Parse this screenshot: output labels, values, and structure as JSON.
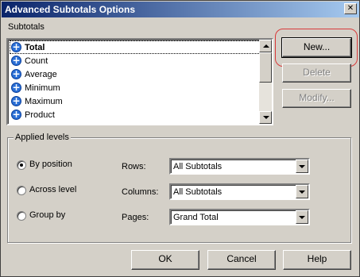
{
  "window": {
    "title": "Advanced Subtotals Options",
    "close_glyph": "✕"
  },
  "subtotals": {
    "label": "Subtotals",
    "items": [
      {
        "label": "Total",
        "icon": "plus-circle-icon"
      },
      {
        "label": "Count",
        "icon": "plus-circle-icon"
      },
      {
        "label": "Average",
        "icon": "plus-circle-icon"
      },
      {
        "label": "Minimum",
        "icon": "plus-circle-icon"
      },
      {
        "label": "Maximum",
        "icon": "plus-circle-icon"
      },
      {
        "label": "Product",
        "icon": "plus-circle-icon"
      }
    ]
  },
  "side_buttons": {
    "new_label": "New...",
    "delete_label": "Delete",
    "modify_label": "Modify..."
  },
  "applied_levels": {
    "title": "Applied levels",
    "radios": [
      {
        "label": "By position",
        "checked": true
      },
      {
        "label": "Across level",
        "checked": false
      },
      {
        "label": "Group by",
        "checked": false
      }
    ],
    "rows_label": "Rows:",
    "rows_value": "All Subtotals",
    "columns_label": "Columns:",
    "columns_value": "All Subtotals",
    "pages_label": "Pages:",
    "pages_value": "Grand Total"
  },
  "footer": {
    "ok_label": "OK",
    "cancel_label": "Cancel",
    "help_label": "Help"
  },
  "colors": {
    "titlebar_start": "#0a246a",
    "titlebar_end": "#a6caf0",
    "highlight": "#d93a3a",
    "dialog_bg": "#d4d0c8"
  }
}
